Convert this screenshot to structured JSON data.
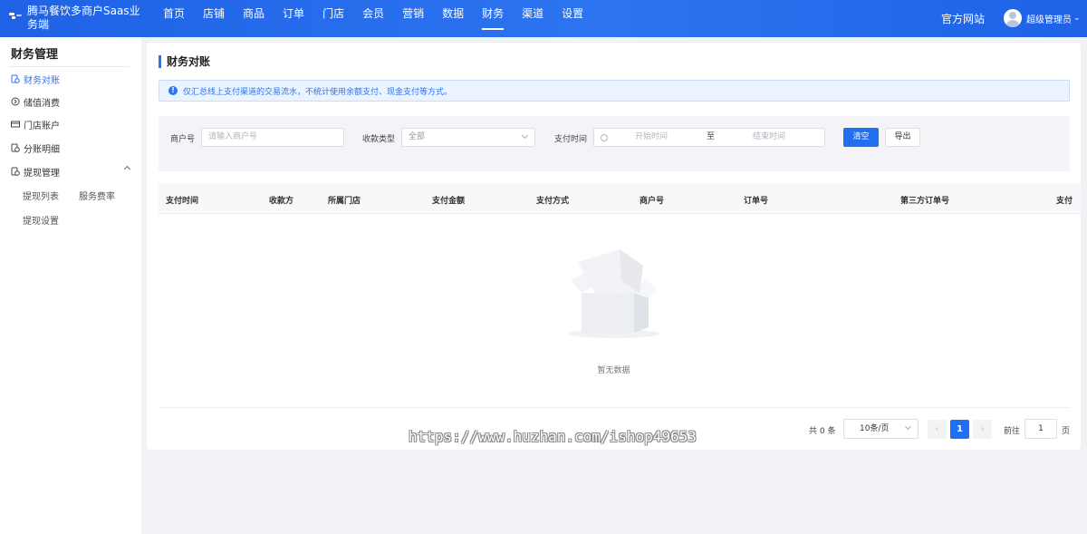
{
  "app": {
    "brand": "腾马餐饮多商户Saas业务端",
    "site_link": "官方网站",
    "user_name": "超级管理员"
  },
  "nav": [
    "首页",
    "店铺",
    "商品",
    "订单",
    "门店",
    "会员",
    "营销",
    "数据",
    "财务",
    "渠道",
    "设置"
  ],
  "nav_active": "财务",
  "sidebar": {
    "title": "财务管理",
    "items": [
      {
        "label": "财务对账",
        "icon": "reconcile-icon",
        "active": true
      },
      {
        "label": "储值消费",
        "icon": "stored-value-icon",
        "active": false
      },
      {
        "label": "门店账户",
        "icon": "store-account-icon",
        "active": false
      },
      {
        "label": "分账明细",
        "icon": "split-detail-icon",
        "active": false
      },
      {
        "label": "提现管理",
        "icon": "withdraw-icon",
        "active": false
      }
    ],
    "subitems": [
      "提现列表",
      "服务费率",
      "提现设置"
    ]
  },
  "page": {
    "title": "财务对账",
    "notice": "仅汇总线上支付渠道的交易流水，不统计使用余额支付、现金支付等方式。"
  },
  "filters": {
    "merchant_label": "商户号",
    "merchant_placeholder": "请输入商户号",
    "type_label": "收款类型",
    "type_value": "全部",
    "time_label": "支付时间",
    "time_start": "开始时间",
    "time_sep": "至",
    "time_end": "结束时间",
    "clear_btn": "清空",
    "export_btn": "导出"
  },
  "table": {
    "columns": [
      "支付时间",
      "收款方",
      "所属门店",
      "支付金额",
      "支付方式",
      "商户号",
      "订单号",
      "第三方订单号",
      "支付"
    ],
    "empty_text": "暂无数据"
  },
  "pagination": {
    "total": "共 0 条",
    "page_size": "10条/页",
    "prev": "‹",
    "current": "1",
    "next": "›",
    "goto_label": "前往",
    "goto_value": "1",
    "page_unit": "页"
  },
  "watermark": "https://www.huzhan.com/ishop49653",
  "colors": {
    "primary": "#2d74f0",
    "topbar": "#1f62e6"
  }
}
